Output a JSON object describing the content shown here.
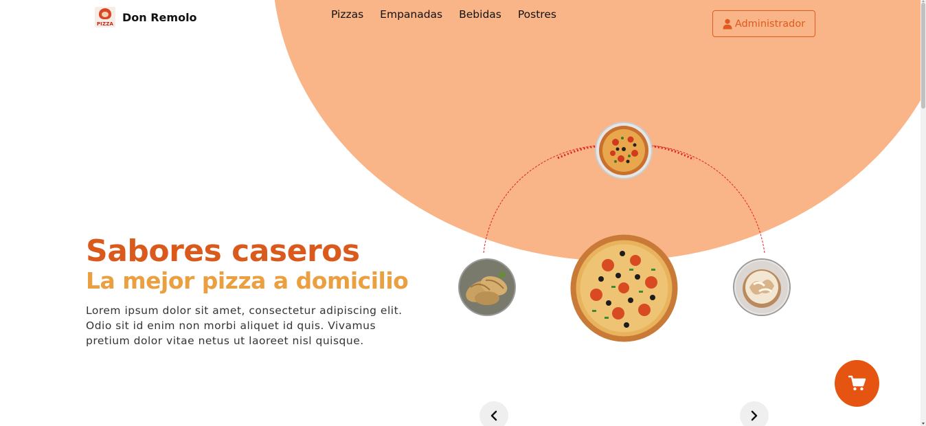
{
  "brand": {
    "name": "Don Remolo",
    "logo_text": "PIZZA"
  },
  "nav": {
    "items": [
      {
        "label": "Pizzas"
      },
      {
        "label": "Empanadas"
      },
      {
        "label": "Bebidas"
      },
      {
        "label": "Postres"
      }
    ]
  },
  "header": {
    "admin_label": "Administrador",
    "admin_icon": "user-icon"
  },
  "hero": {
    "title": "Sabores caseros",
    "subtitle": "La mejor pizza a domicilio",
    "body": "Lorem ipsum dolor sit amet, consectetur adipiscing elit. Odio sit id enim non morbi aliquet id quis. Vivamus pretium dolor vitae netus ut laoreet nisl quisque."
  },
  "carousel": {
    "items": [
      {
        "name": "pizza-top-image"
      },
      {
        "name": "empanadas-image"
      },
      {
        "name": "pizza-main-image"
      },
      {
        "name": "postre-image"
      }
    ],
    "prev_icon": "chevron-left-icon",
    "next_icon": "chevron-right-icon"
  },
  "cart": {
    "icon": "cart-icon"
  },
  "colors": {
    "accent": "#e65411",
    "title": "#d95a1c",
    "subtitle": "#ea9f41",
    "background_circle": "#f9b487",
    "orbit_line": "#e0201c"
  }
}
